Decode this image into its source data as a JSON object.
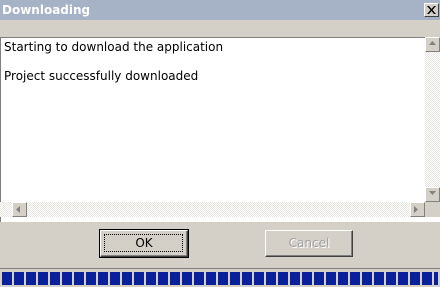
{
  "window": {
    "title": "Downloading",
    "close_icon": "close-icon"
  },
  "log": {
    "lines": [
      "Starting to download the application",
      "Project successfully downloaded"
    ]
  },
  "buttons": {
    "ok_label": "OK",
    "cancel_label": "Cancel"
  },
  "progress": {
    "percent": 100,
    "color": "#0a1f9a"
  },
  "colors": {
    "titlebar": "#a6b3c6",
    "window_bg": "#d4d0c8"
  }
}
